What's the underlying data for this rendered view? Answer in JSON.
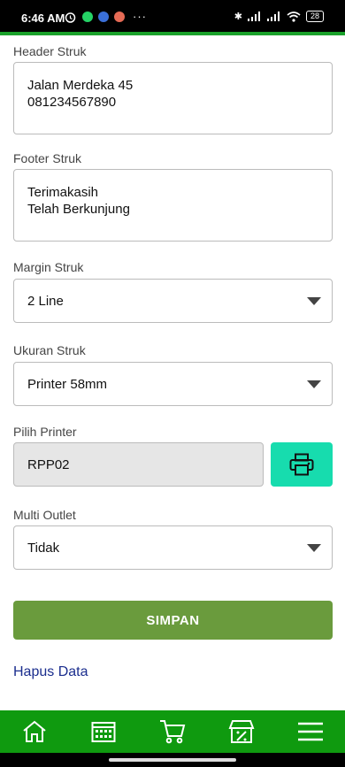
{
  "status_bar": {
    "time": "6:46 AM",
    "battery": "28"
  },
  "form": {
    "header": {
      "label": "Header Struk",
      "line1": "Jalan Merdeka 45",
      "line2": "081234567890"
    },
    "footer": {
      "label": "Footer Struk",
      "line1": "Terimakasih",
      "line2": "Telah Berkunjung"
    },
    "margin": {
      "label": "Margin Struk",
      "value": "2 Line"
    },
    "size": {
      "label": "Ukuran Struk",
      "value": "Printer 58mm"
    },
    "printer": {
      "label": "Pilih Printer",
      "value": "RPP02",
      "icon": "printer-icon"
    },
    "multi_outlet": {
      "label": "Multi Outlet",
      "value": "Tidak"
    }
  },
  "actions": {
    "save_label": "SIMPAN",
    "delete_label": "Hapus Data"
  },
  "bottom_nav": [
    {
      "icon": "home-icon"
    },
    {
      "icon": "calendar-icon"
    },
    {
      "icon": "cart-icon"
    },
    {
      "icon": "store-icon"
    },
    {
      "icon": "menu-icon"
    }
  ],
  "colors": {
    "accent_green": "#0f9a0f",
    "save_button": "#6a9b3d",
    "printer_button": "#17dcae",
    "link": "#1b2e8e"
  }
}
